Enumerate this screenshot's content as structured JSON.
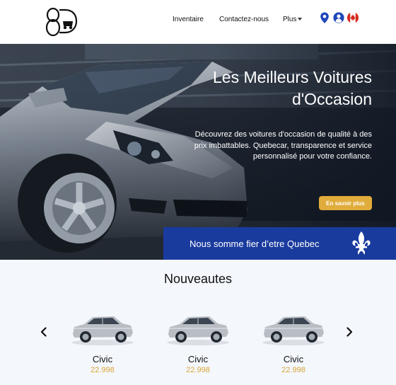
{
  "header": {
    "logo_text": "8D",
    "nav": [
      {
        "label": "Inventaire"
      },
      {
        "label": "Contactez-nous"
      },
      {
        "label": "Plus"
      }
    ],
    "icons": [
      "location-pin-icon",
      "user-icon",
      "canada-flag-icon"
    ]
  },
  "hero": {
    "title": "Les Meilleurs  Voitures\nd'Occasion",
    "description": "Découvrez des voitures d'occasion de qualité à des prix imbattables. Quebecar, transparence et service personnalisé pour votre confiance.",
    "cta_label": "En savoir plus",
    "band_text": "Nous somme fier d’etre Quebec"
  },
  "nouveautes": {
    "title": "Nouveautes",
    "cars": [
      {
        "name": "Civic",
        "price": "22.998"
      },
      {
        "name": "Civic",
        "price": "22.998"
      },
      {
        "name": "Civic",
        "price": "22.998"
      }
    ]
  },
  "colors": {
    "accent_gold": "#e0ac3c",
    "quebec_blue": "#1a3b9e",
    "pin_blue": "#1e47b8"
  }
}
